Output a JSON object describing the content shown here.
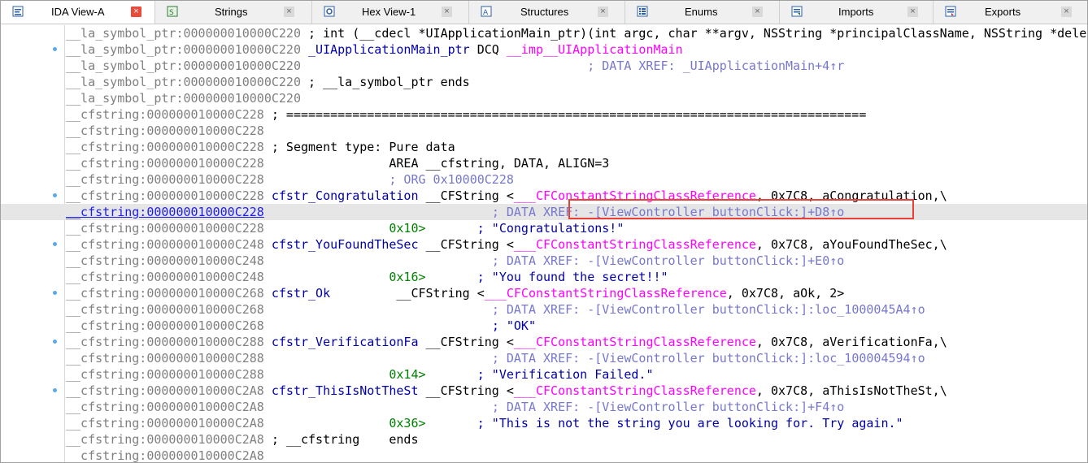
{
  "tabs": [
    {
      "label": "IDA View-A",
      "icon": "ida-view-icon",
      "close": "close-icon",
      "active": true
    },
    {
      "label": "Strings",
      "icon": "strings-icon",
      "close": "close-icon",
      "active": false
    },
    {
      "label": "Hex View-1",
      "icon": "hex-view-icon",
      "close": "close-icon",
      "active": false
    },
    {
      "label": "Structures",
      "icon": "structures-icon",
      "close": "close-icon",
      "active": false
    },
    {
      "label": "Enums",
      "icon": "enums-icon",
      "close": "close-icon",
      "active": false
    },
    {
      "label": "Imports",
      "icon": "imports-icon",
      "close": "close-icon",
      "active": false
    },
    {
      "label": "Exports",
      "icon": "exports-icon",
      "close": "close-icon",
      "active": false
    }
  ],
  "close_glyph": "×",
  "lines": [
    {
      "addr": "__la_symbol_ptr:000000010000C220",
      "text": " ; int (__cdecl *UIApplicationMain_ptr)(int argc, char **argv, NSString *principalClassName, NSString *delegateClassName)"
    },
    {
      "addr": "__la_symbol_ptr:000000010000C220",
      "name": " _UIApplicationMain_ptr",
      "op": " DCQ ",
      "ext": "__imp__UIApplicationMain"
    },
    {
      "addr": "__la_symbol_ptr:000000010000C220",
      "pad": "                                       ",
      "comment": "; DATA XREF: _UIApplicationMain+4↑r"
    },
    {
      "addr": "__la_symbol_ptr:000000010000C220",
      "text": " ; __la_symbol_ptr ends"
    },
    {
      "addr": "__la_symbol_ptr:000000010000C220"
    },
    {
      "addr": "__cfstring:000000010000C228",
      "text": " ; ==============================================================================="
    },
    {
      "addr": "__cfstring:000000010000C228"
    },
    {
      "addr": "__cfstring:000000010000C228",
      "text": " ; Segment type: Pure data"
    },
    {
      "addr": "__cfstring:000000010000C228",
      "text": "                 AREA __cfstring, DATA, ALIGN=3"
    },
    {
      "addr": "__cfstring:000000010000C228",
      "pad": "                 ",
      "comment": "; ORG 0x10000C228"
    },
    {
      "addr": "__cfstring:000000010000C228",
      "name": " cfstr_Congratulation",
      "op": " __CFString <",
      "ext": "___CFConstantStringClassReference",
      "tail": ", 0x7C8, aCongratulation,\\"
    },
    {
      "addr": "__cfstring:000000010000C228",
      "pad": "                               ",
      "comment": "; DATA XREF: -[ViewController buttonClick:]+D8↑o",
      "highlight": true
    },
    {
      "addr": "__cfstring:000000010000C228",
      "num": "0x10>",
      "op2": "       ; \"Congratulations!\""
    },
    {
      "addr": "__cfstring:000000010000C248",
      "name": " cfstr_YouFoundTheSec",
      "op": " __CFString <",
      "ext": "___CFConstantStringClassReference",
      "tail": ", 0x7C8, aYouFoundTheSec,\\"
    },
    {
      "addr": "__cfstring:000000010000C248",
      "pad": "                               ",
      "comment": "; DATA XREF: -[ViewController buttonClick:]+E0↑o"
    },
    {
      "addr": "__cfstring:000000010000C248",
      "num": "0x16>",
      "op2": "       ; \"You found the secret!!\""
    },
    {
      "addr": "__cfstring:000000010000C268",
      "name": " cfstr_Ok",
      "op": "         __CFString <",
      "ext": "___CFConstantStringClassReference",
      "tail": ", 0x7C8, aOk, 2>"
    },
    {
      "addr": "__cfstring:000000010000C268",
      "pad": "                               ",
      "comment": "; DATA XREF: -[ViewController buttonClick:]:loc_1000045A4↑o"
    },
    {
      "addr": "__cfstring:000000010000C268",
      "pad": "                               ",
      "op2": "; \"OK\""
    },
    {
      "addr": "__cfstring:000000010000C288",
      "name": " cfstr_VerificationFa",
      "op": " __CFString <",
      "ext": "___CFConstantStringClassReference",
      "tail": ", 0x7C8, aVerificationFa,\\"
    },
    {
      "addr": "__cfstring:000000010000C288",
      "pad": "                               ",
      "comment": "; DATA XREF: -[ViewController buttonClick:]:loc_100004594↑o"
    },
    {
      "addr": "__cfstring:000000010000C288",
      "num": "0x14>",
      "op2": "       ; \"Verification Failed.\""
    },
    {
      "addr": "__cfstring:000000010000C2A8",
      "name": " cfstr_ThisIsNotTheSt",
      "op": " __CFString <",
      "ext": "___CFConstantStringClassReference",
      "tail": ", 0x7C8, aThisIsNotTheSt,\\"
    },
    {
      "addr": "__cfstring:000000010000C2A8",
      "pad": "                               ",
      "comment": "; DATA XREF: -[ViewController buttonClick:]+F4↑o"
    },
    {
      "addr": "__cfstring:000000010000C2A8",
      "num": "0x36>",
      "op2": "       ; \"This is not the string you are looking for. Try again.\""
    },
    {
      "addr": "__cfstring:000000010000C2A8",
      "text": " ; __cfstring    ends"
    },
    {
      "addr": "__cfstring:000000010000C2A8"
    }
  ],
  "dot_rows": [
    1,
    10,
    13,
    16,
    19,
    22
  ]
}
